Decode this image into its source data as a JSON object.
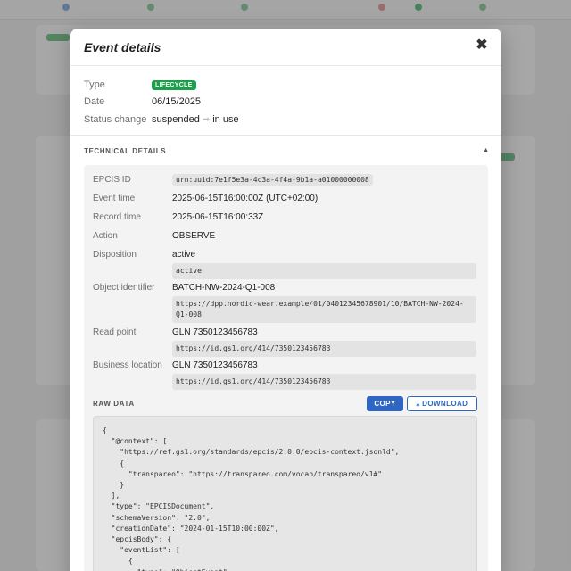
{
  "modal": {
    "title": "Event details",
    "close_label": "✖"
  },
  "summary": {
    "type_label": "Type",
    "type_badge": "LIFECYCLE",
    "date_label": "Date",
    "date_value": "06/15/2025",
    "status_label": "Status change",
    "status_from": "suspended",
    "status_to": "in use"
  },
  "technical": {
    "section_title": "TECHNICAL DETAILS",
    "epcis_id_label": "EPCIS ID",
    "epcis_id_value": "urn:uuid:7e1f5e3a-4c3a-4f4a-9b1a-a01000000008",
    "event_time_label": "Event time",
    "event_time_value": "2025-06-15T16:00:00Z (UTC+02:00)",
    "record_time_label": "Record time",
    "record_time_value": "2025-06-15T16:00:33Z",
    "action_label": "Action",
    "action_value": "OBSERVE",
    "disposition_label": "Disposition",
    "disposition_value": "active",
    "disposition_code": "active",
    "object_label": "Object identifier",
    "object_value": "BATCH-NW-2024-Q1-008",
    "object_code_line1": "https://dpp.nordic-wear.example/01/04012345678901/10/BATCH-NW-2024-",
    "object_code_line2": "Q1-008",
    "read_point_label": "Read point",
    "read_point_value": "GLN 7350123456783",
    "read_point_code": "https://id.gs1.org/414/7350123456783",
    "biz_location_label": "Business location",
    "biz_location_value": "GLN 7350123456783",
    "biz_location_code": "https://id.gs1.org/414/7350123456783"
  },
  "raw": {
    "title": "RAW DATA",
    "copy_label": "COPY",
    "download_label": "DOWNLOAD",
    "download_icon": "download-icon",
    "json_lines": [
      "{",
      "  \"@context\": [",
      "    \"https://ref.gs1.org/standards/epcis/2.0.0/epcis-context.jsonld\",",
      "    {",
      "      \"transpareo\": \"https://transpareo.com/vocab/transpareo/v1#\"",
      "    }",
      "  ],",
      "  \"type\": \"EPCISDocument\",",
      "  \"schemaVersion\": \"2.0\",",
      "  \"creationDate\": \"2024-01-15T10:00:00Z\",",
      "  \"epcisBody\": {",
      "    \"eventList\": [",
      "      {",
      "        \"type\": \"ObjectEvent\","
    ]
  },
  "colors": {
    "badge_green": "#1e9e4a",
    "primary_blue": "#2f66c4"
  }
}
